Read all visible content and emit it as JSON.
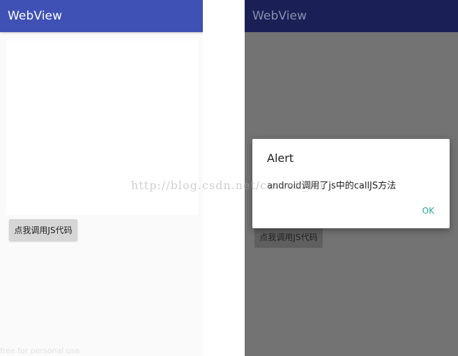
{
  "left_screen": {
    "app_bar": {
      "title": "WebView"
    },
    "call_js_button": {
      "label": "点我调用JS代码"
    },
    "bottom_watermark": "free for personal use"
  },
  "right_screen": {
    "app_bar": {
      "title": "WebView"
    },
    "call_js_button": {
      "label": "点我调用JS代码"
    },
    "alert_dialog": {
      "title": "Alert",
      "message": "android调用了js中的callJS方法",
      "ok_label": "OK"
    }
  },
  "overlay_watermark": "http://blog.csdn.net/carson_ho",
  "colors": {
    "left_app_bar": "#3f51b5",
    "right_app_bar_dimmed": "#1a1f56",
    "dim_scrim": "#737373",
    "dialog_ok_accent": "#26a69a",
    "button_background": "#d6d6d6"
  }
}
